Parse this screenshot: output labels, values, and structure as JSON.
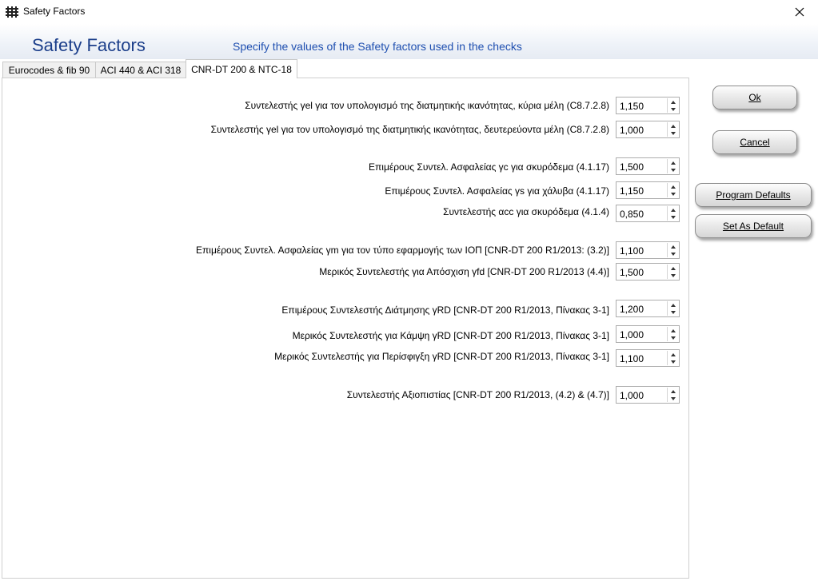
{
  "window": {
    "title": "Safety Factors",
    "icon": "grid-app-icon"
  },
  "header": {
    "title": "Safety Factors",
    "subtitle": "Specify the values of the Safety factors used in the checks"
  },
  "tabs": [
    {
      "label": "Eurocodes & fib 90",
      "active": false
    },
    {
      "label": "ACI 440 & ACI 318",
      "active": false
    },
    {
      "label": "CNR-DT 200 & NTC-18",
      "active": true
    }
  ],
  "fields": [
    {
      "label": "Συντελεστής γel για τον υπολογισμό της διατμητικής ικανότητας, κύρια μέλη (C8.7.2.8)",
      "value": "1,150"
    },
    {
      "label": "Συντελεστής γel για τον υπολογισμό της διατμητικής ικανότητας, δευτερεύοντα μέλη (C8.7.2.8)",
      "value": "1,000"
    },
    {
      "label": "Επιμέρους Συντελ. Ασφαλείας γc για σκυρόδεμα (4.1.17)",
      "value": "1,500"
    },
    {
      "label": "Επιμέρους Συντελ. Ασφαλείας γs για χάλυβα (4.1.17)",
      "value": "1,150"
    },
    {
      "label": "Συντελεστής αcc για σκυρόδεμα (4.1.4)",
      "value": "0,850"
    },
    {
      "label": "Επιμέρους Συντελ. Ασφαλείας γm για τον τύπο εφαρμογής των ΙΟΠ [CNR-DT 200 R1/2013: (3.2)]",
      "value": "1,100"
    },
    {
      "label": "Μερικός Συντελεστής για Απόσχιση γfd [CNR-DT 200 R1/2013 (4.4)]",
      "value": "1,500"
    },
    {
      "label": "Επιμέρους Συντελεστής Διάτμησης γRD [CNR-DT 200 R1/2013, Πίνακας 3-1]",
      "value": "1,200"
    },
    {
      "label": "Μερικός Συντελεστής για Κάμψη γRD [CNR-DT 200 R1/2013, Πίνακας 3-1]",
      "value": "1,000"
    },
    {
      "label": "Μερικός Συντελεστής για Περίσφιγξη γRD [CNR-DT 200 R1/2013, Πίνακας 3-1]",
      "value": "1,100"
    },
    {
      "label": "Συντελεστής Αξιοπιστίας [CNR-DT 200 R1/2013, (4.2) & (4.7)]",
      "value": "1,000"
    }
  ],
  "buttons": {
    "ok": "Ok",
    "cancel": "Cancel",
    "program_defaults": "Program Defaults",
    "set_as_default": "Set As Default"
  },
  "colors": {
    "title": "#1b3e8a",
    "subtitle": "#1f4fb0"
  }
}
